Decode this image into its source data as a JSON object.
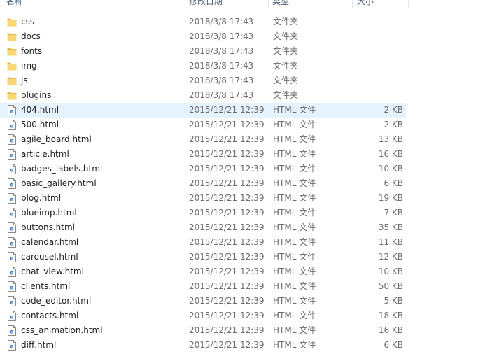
{
  "columns": {
    "name": "名称",
    "date": "修改日期",
    "type": "类型",
    "size": "大小"
  },
  "colors": {
    "folder": "#f8d775",
    "folder_dark": "#e6b84a",
    "html_icon": "#2b79d0",
    "hover": "#e5f3ff"
  },
  "files": [
    {
      "name": "css",
      "date": "2018/3/8 17:43",
      "type": "文件夹",
      "size": "",
      "kind": "folder"
    },
    {
      "name": "docs",
      "date": "2018/3/8 17:43",
      "type": "文件夹",
      "size": "",
      "kind": "folder"
    },
    {
      "name": "fonts",
      "date": "2018/3/8 17:43",
      "type": "文件夹",
      "size": "",
      "kind": "folder"
    },
    {
      "name": "img",
      "date": "2018/3/8 17:43",
      "type": "文件夹",
      "size": "",
      "kind": "folder"
    },
    {
      "name": "js",
      "date": "2018/3/8 17:43",
      "type": "文件夹",
      "size": "",
      "kind": "folder"
    },
    {
      "name": "plugins",
      "date": "2018/3/8 17:43",
      "type": "文件夹",
      "size": "",
      "kind": "folder"
    },
    {
      "name": "404.html",
      "date": "2015/12/21 12:39",
      "type": "HTML 文件",
      "size": "2 KB",
      "kind": "html",
      "hover": true
    },
    {
      "name": "500.html",
      "date": "2015/12/21 12:39",
      "type": "HTML 文件",
      "size": "2 KB",
      "kind": "html"
    },
    {
      "name": "agile_board.html",
      "date": "2015/12/21 12:39",
      "type": "HTML 文件",
      "size": "13 KB",
      "kind": "html"
    },
    {
      "name": "article.html",
      "date": "2015/12/21 12:39",
      "type": "HTML 文件",
      "size": "16 KB",
      "kind": "html"
    },
    {
      "name": "badges_labels.html",
      "date": "2015/12/21 12:39",
      "type": "HTML 文件",
      "size": "10 KB",
      "kind": "html"
    },
    {
      "name": "basic_gallery.html",
      "date": "2015/12/21 12:39",
      "type": "HTML 文件",
      "size": "6 KB",
      "kind": "html"
    },
    {
      "name": "blog.html",
      "date": "2015/12/21 12:39",
      "type": "HTML 文件",
      "size": "19 KB",
      "kind": "html"
    },
    {
      "name": "blueimp.html",
      "date": "2015/12/21 12:39",
      "type": "HTML 文件",
      "size": "7 KB",
      "kind": "html"
    },
    {
      "name": "buttons.html",
      "date": "2015/12/21 12:39",
      "type": "HTML 文件",
      "size": "35 KB",
      "kind": "html"
    },
    {
      "name": "calendar.html",
      "date": "2015/12/21 12:39",
      "type": "HTML 文件",
      "size": "11 KB",
      "kind": "html"
    },
    {
      "name": "carousel.html",
      "date": "2015/12/21 12:39",
      "type": "HTML 文件",
      "size": "12 KB",
      "kind": "html"
    },
    {
      "name": "chat_view.html",
      "date": "2015/12/21 12:39",
      "type": "HTML 文件",
      "size": "10 KB",
      "kind": "html"
    },
    {
      "name": "clients.html",
      "date": "2015/12/21 12:39",
      "type": "HTML 文件",
      "size": "50 KB",
      "kind": "html"
    },
    {
      "name": "code_editor.html",
      "date": "2015/12/21 12:39",
      "type": "HTML 文件",
      "size": "5 KB",
      "kind": "html"
    },
    {
      "name": "contacts.html",
      "date": "2015/12/21 12:39",
      "type": "HTML 文件",
      "size": "18 KB",
      "kind": "html"
    },
    {
      "name": "css_animation.html",
      "date": "2015/12/21 12:39",
      "type": "HTML 文件",
      "size": "16 KB",
      "kind": "html"
    },
    {
      "name": "diff.html",
      "date": "2015/12/21 12:39",
      "type": "HTML 文件",
      "size": "6 KB",
      "kind": "html"
    }
  ]
}
